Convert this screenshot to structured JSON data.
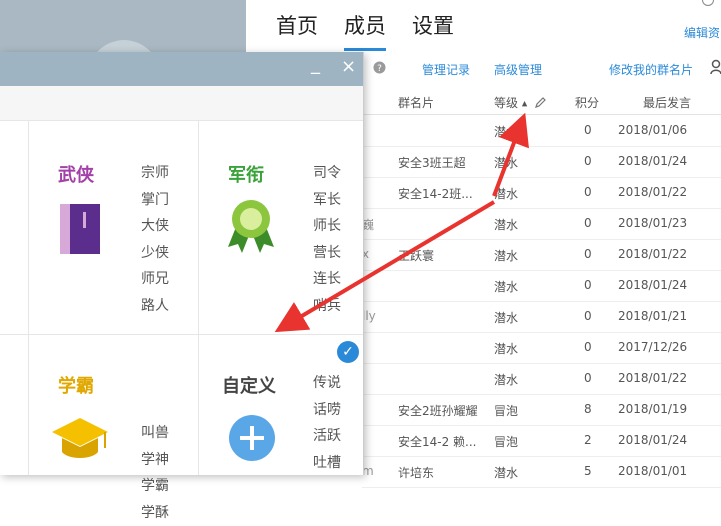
{
  "header": {
    "tabs": [
      {
        "label": "首页"
      },
      {
        "label": "成员",
        "active": true
      },
      {
        "label": "设置"
      }
    ],
    "edit_link": "编辑资"
  },
  "toolbar": {
    "manage_records": "管理记录",
    "advanced_manage": "高级管理",
    "edit_my_card": "修改我的群名片"
  },
  "table": {
    "headers": {
      "card": "群名片",
      "level": "等级",
      "points": "积分",
      "last": "最后发言"
    },
    "rows": [
      {
        "lead": "",
        "card": "",
        "level": "潜水",
        "points": "0",
        "date": "2018/01/06"
      },
      {
        "lead": "",
        "card": "安全3班王超",
        "level": "潜水",
        "points": "0",
        "date": "2018/01/24"
      },
      {
        "lead": "",
        "card": "安全14-2班...",
        "level": "潜水",
        "points": "0",
        "date": "2018/01/22"
      },
      {
        "lead": "巍",
        "card": "",
        "level": "潜水",
        "points": "0",
        "date": "2018/01/23"
      },
      {
        "lead": "x",
        "card": "王跃寰",
        "level": "潜水",
        "points": "0",
        "date": "2018/01/22"
      },
      {
        "lead": "",
        "card": "",
        "level": "潜水",
        "points": "0",
        "date": "2018/01/24"
      },
      {
        "lead": "lly",
        "card": "",
        "level": "潜水",
        "points": "0",
        "date": "2018/01/21"
      },
      {
        "lead": "",
        "card": "",
        "level": "潜水",
        "points": "0",
        "date": "2017/12/26"
      },
      {
        "lead": "",
        "card": "",
        "level": "潜水",
        "points": "0",
        "date": "2018/01/22"
      },
      {
        "lead": "",
        "card": "安全2班孙耀耀",
        "level": "冒泡",
        "points": "8",
        "date": "2018/01/19"
      },
      {
        "lead": "",
        "card": "安全14-2 赖...",
        "level": "冒泡",
        "points": "2",
        "date": "2018/01/24"
      },
      {
        "lead": "m",
        "card": "许培东",
        "level": "潜水",
        "points": "5",
        "date": "2018/01/01"
      }
    ]
  },
  "dialog": {
    "minimize": "_",
    "close": "×",
    "groups": {
      "wuxia": {
        "title": "武侠",
        "color": "#a341a8",
        "items": [
          "宗师",
          "掌门",
          "大侠",
          "少侠",
          "师兄",
          "路人"
        ]
      },
      "junxian": {
        "title": "军衔",
        "color": "#3aa23a",
        "items": [
          "司令",
          "军长",
          "师长",
          "营长",
          "连长",
          "哨兵"
        ]
      },
      "xueba": {
        "title": "学霸",
        "color": "#e0a800",
        "items": [
          "叫兽",
          "学神",
          "学霸",
          "学酥"
        ]
      },
      "custom": {
        "title": "自定义",
        "color": "#444444",
        "items": [
          "传说",
          "话唠",
          "活跃",
          "吐槽"
        ]
      }
    },
    "check": "✓"
  },
  "colors": {
    "accent": "#2b8ad8",
    "arrow": "#e8332f",
    "title_bar": "#9fb4c3"
  }
}
